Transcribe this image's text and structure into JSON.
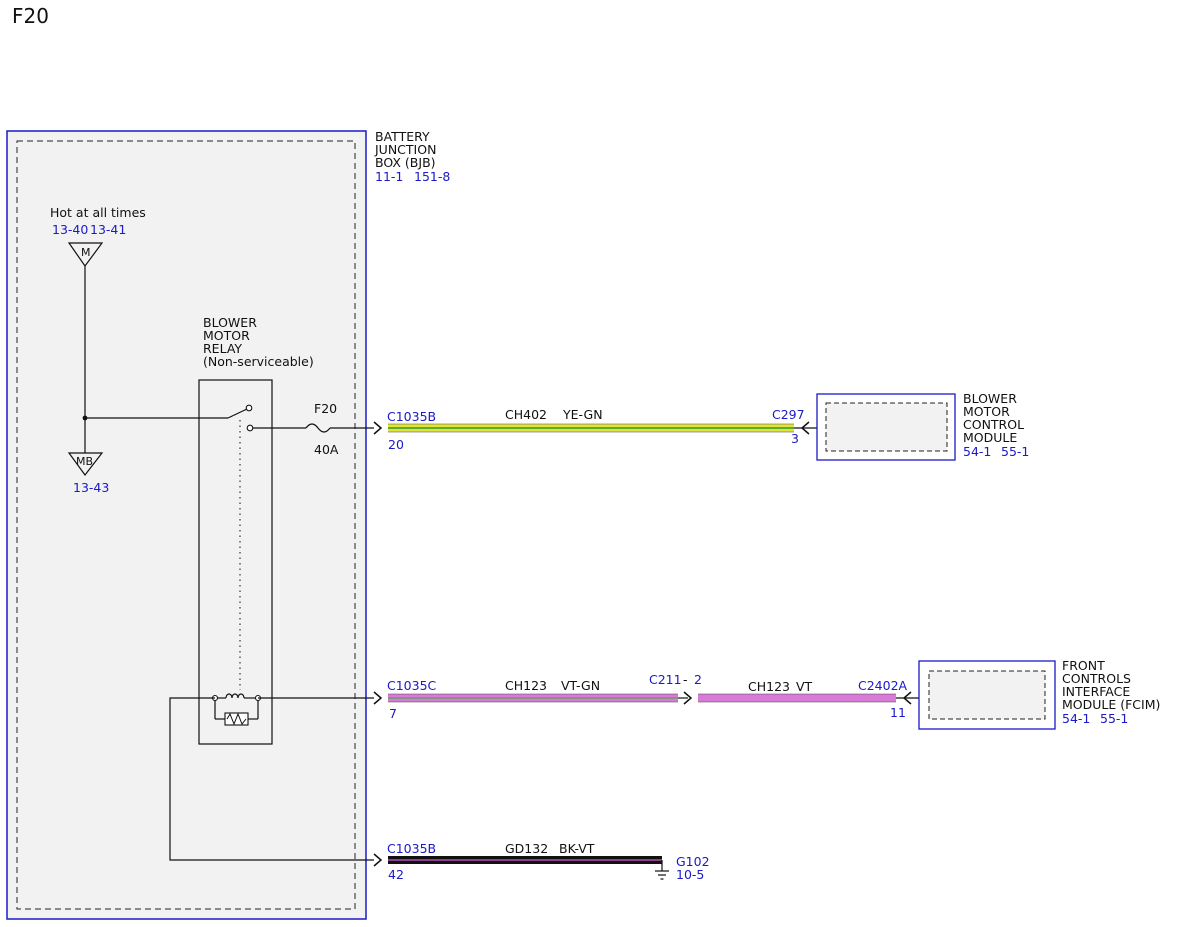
{
  "page_title": "F20",
  "bjb": {
    "name": [
      "BATTERY",
      "JUNCTION",
      "BOX (BJB)"
    ],
    "refs": [
      "11-1",
      "151-8"
    ]
  },
  "power": {
    "label": "Hot at all times",
    "refs": [
      "13-40",
      "13-41"
    ],
    "bus_top": "M",
    "bus_bottom": "MB",
    "bus_bottom_ref": "13-43"
  },
  "relay": {
    "name": [
      "BLOWER",
      "MOTOR",
      "RELAY",
      "(Non-serviceable)"
    ]
  },
  "fuse": {
    "name": "F20",
    "rating": "40A"
  },
  "circuits": [
    {
      "connector": "C1035B",
      "pin": "20",
      "circuit": "CH402",
      "color_code": "YE-GN",
      "dest_connector": "C297",
      "dest_pin": "3"
    },
    {
      "connector": "C1035C",
      "pin": "7",
      "circuit": "CH123",
      "color_code": "VT-GN",
      "inline_connector": "C211",
      "inline_sep": "-",
      "inline_pin": "2",
      "circuit2": "CH123",
      "color_code2": "VT",
      "dest_connector": "C2402A",
      "dest_pin": "11"
    },
    {
      "connector": "C1035B",
      "pin": "42",
      "circuit": "GD132",
      "color_code": "BK-VT",
      "ground": "G102",
      "ground_ref": "10-5"
    }
  ],
  "modules": {
    "bmcm": {
      "name": [
        "BLOWER",
        "MOTOR",
        "CONTROL",
        "MODULE"
      ],
      "refs": [
        "54-1",
        "55-1"
      ]
    },
    "fcim": {
      "name": [
        "FRONT",
        "CONTROLS",
        "INTERFACE",
        "MODULE (FCIM)"
      ],
      "refs": [
        "54-1",
        "55-1"
      ]
    }
  },
  "wire_colors": {
    "ye_gn_main": "#e3e43a",
    "ye_gn_stripe": "#2f9a2f",
    "vt_main": "#d97ad9",
    "vt_gn_stripe": "#6a9a6a",
    "bk": "#111111",
    "bk_vt_stripe": "#b64fb6"
  },
  "colors": {
    "border_blue": "#1a1ac8",
    "panel_fill": "#f2f2f2",
    "ref_blue": "#1a1ac8"
  }
}
